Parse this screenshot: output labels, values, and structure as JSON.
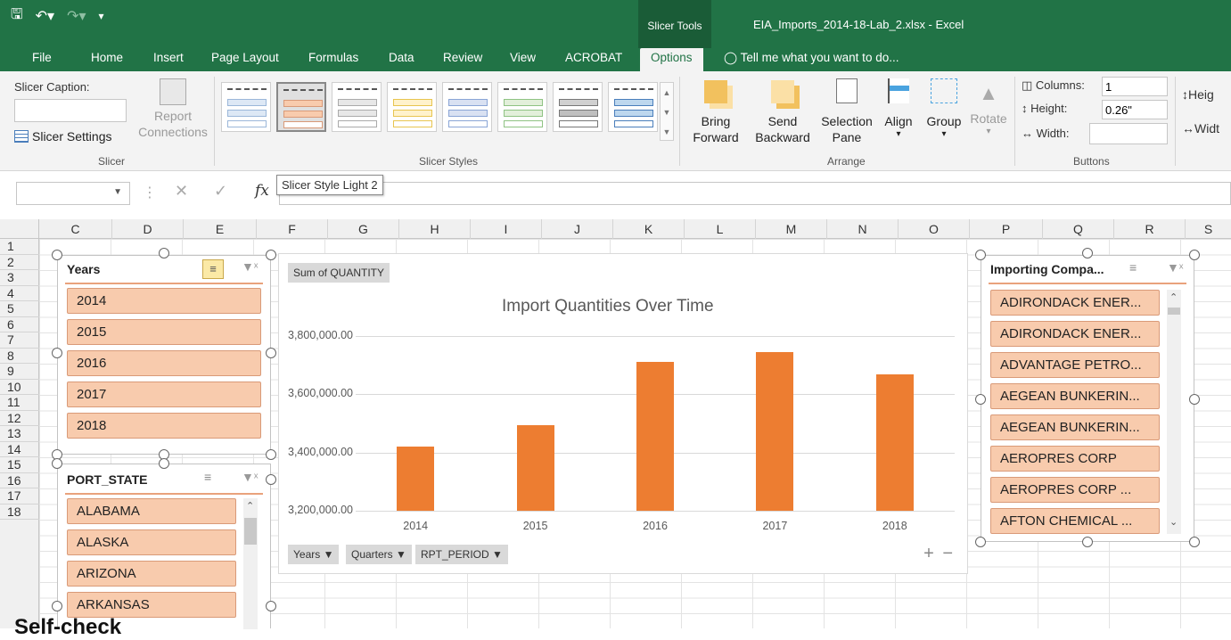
{
  "window": {
    "contextual_tab_group": "Slicer Tools",
    "title": "EIA_Imports_2014-18-Lab_2.xlsx - Excel"
  },
  "tabs": [
    "File",
    "Home",
    "Insert",
    "Page Layout",
    "Formulas",
    "Data",
    "Review",
    "View",
    "ACROBAT",
    "Options"
  ],
  "tell_me": "Tell me what you want to do...",
  "ribbon": {
    "slicer_group": {
      "caption_label": "Slicer Caption:",
      "caption_value": "",
      "settings_label": "Slicer Settings",
      "report_connections_1": "Report",
      "report_connections_2": "Connections",
      "group_label": "Slicer"
    },
    "styles_group": {
      "group_label": "Slicer Styles"
    },
    "arrange_group": {
      "bring_forward_1": "Bring",
      "bring_forward_2": "Forward",
      "send_backward_1": "Send",
      "send_backward_2": "Backward",
      "selection_pane_1": "Selection",
      "selection_pane_2": "Pane",
      "align": "Align",
      "group": "Group",
      "rotate": "Rotate",
      "group_label": "Arrange"
    },
    "buttons_group": {
      "columns_label": "Columns:",
      "columns_value": "1",
      "height_label": "Height:",
      "height_value": "0.26\"",
      "width_label": "Width:",
      "width_value": "",
      "group_label": "Buttons"
    },
    "size_group": {
      "height_label": "Heig",
      "width_label": "Widt"
    }
  },
  "formula_bar": {
    "namebox": "",
    "fx": "fx",
    "value": ""
  },
  "tooltip": "Slicer Style Light 2",
  "columns": [
    "C",
    "D",
    "E",
    "F",
    "G",
    "H",
    "I",
    "J",
    "K",
    "L",
    "M",
    "N",
    "O",
    "P",
    "Q",
    "R",
    "S"
  ],
  "rows": [
    "1",
    "2",
    "3",
    "4",
    "5",
    "6",
    "7",
    "8",
    "9",
    "10",
    "11",
    "12",
    "13",
    "14",
    "15",
    "16",
    "17",
    "18"
  ],
  "slicers": {
    "years": {
      "title": "Years",
      "items": [
        "2014",
        "2015",
        "2016",
        "2017",
        "2018"
      ]
    },
    "port_state": {
      "title": "PORT_STATE",
      "items": [
        "ALABAMA",
        "ALASKA",
        "ARIZONA",
        "ARKANSAS"
      ]
    },
    "importing": {
      "title": "Importing Compa...",
      "items": [
        "ADIRONDACK ENER...",
        "ADIRONDACK ENER...",
        "ADVANTAGE PETRO...",
        "AEGEAN BUNKERIN...",
        "AEGEAN BUNKERIN...",
        "AEROPRES CORP",
        "AEROPRES CORP     ...",
        "AFTON CHEMICAL ..."
      ]
    }
  },
  "chart": {
    "field_button": "Sum of QUANTITY",
    "axis_buttons": [
      "Years",
      "Quarters",
      "RPT_PERIOD"
    ],
    "zoom": "+ −"
  },
  "chart_data": {
    "type": "bar",
    "title": "Import Quantities Over Time",
    "categories": [
      "2014",
      "2015",
      "2016",
      "2017",
      "2018"
    ],
    "values": [
      3420000,
      3495000,
      3712000,
      3745000,
      3668000
    ],
    "ylim": [
      3200000,
      3800000
    ],
    "yticks": [
      "3,200,000.00",
      "3,400,000.00",
      "3,600,000.00",
      "3,800,000.00"
    ],
    "ytick_values": [
      3200000,
      3400000,
      3600000,
      3800000
    ],
    "color": "#ed7d31",
    "grid": true
  },
  "bottom_text": "Self-check"
}
